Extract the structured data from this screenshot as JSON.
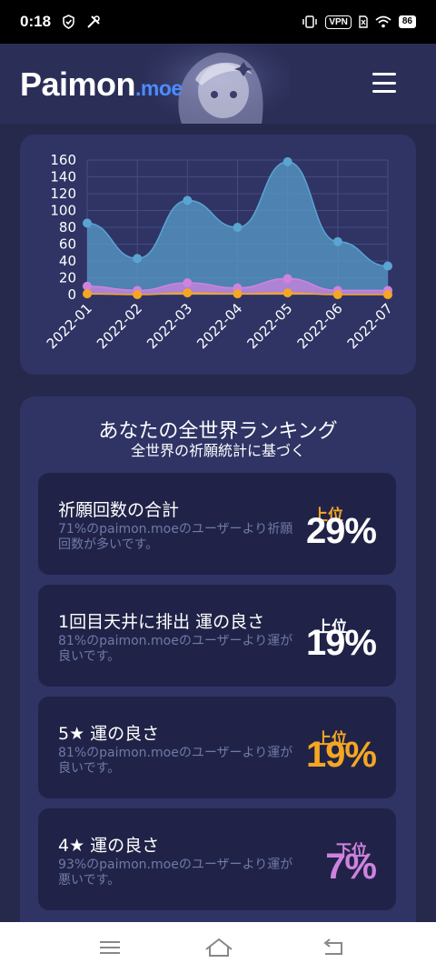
{
  "status_bar": {
    "time": "0:18",
    "vpn_label": "VPN",
    "battery_level": "86",
    "icons": [
      "shield-check-icon",
      "tools-icon",
      "vibrate-icon",
      "vpn-icon",
      "sim-icon",
      "wifi-icon",
      "battery-icon"
    ]
  },
  "header": {
    "logo_main": "Paimon",
    "logo_suffix": ".moe",
    "menu_icon": "hamburger-menu-icon",
    "art": "paimon-character-art"
  },
  "colors": {
    "page_bg": "#26294b",
    "card_bg": "#2f3465",
    "item_bg": "#202347",
    "accent_blue": "#4d8bff",
    "five_star": "#f5a623",
    "four_star": "#cf82e0",
    "total_area": "#4a8fc0"
  },
  "chart_data": {
    "type": "area",
    "x": [
      "2022-01",
      "2022-02",
      "2022-03",
      "2022-04",
      "2022-05",
      "2022-06",
      "2022-07"
    ],
    "ylim": [
      0,
      160
    ],
    "yticks": [
      0,
      20,
      40,
      60,
      80,
      100,
      120,
      140,
      160
    ],
    "grid": true,
    "series": [
      {
        "color": "#5aa4d2",
        "values": [
          85,
          43,
          112,
          80,
          158,
          63,
          34
        ]
      },
      {
        "color": "#cf82e0",
        "values": [
          10,
          5,
          14,
          8,
          19,
          5,
          5
        ]
      },
      {
        "color": "#f5a623",
        "values": [
          1,
          0,
          2,
          1,
          2,
          0,
          0
        ]
      }
    ]
  },
  "ranking": {
    "title": "あなたの全世界ランキング",
    "subtitle": "全世界の祈願統計に基づく",
    "items": [
      {
        "label": "祈願回数の合計",
        "desc": "71%のpaimon.moeのユーザーより祈願回数が多いです。",
        "position": "上位",
        "percent": "29%",
        "pos_color": "#f5a623",
        "pct_color": "#ffffff"
      },
      {
        "label": "1回目天井に排出 運の良さ",
        "desc": "81%のpaimon.moeのユーザーより運が良いです。",
        "position": "上位",
        "percent": "19%",
        "pos_color": "#ffffff",
        "pct_color": "#ffffff"
      },
      {
        "label": "5★ 運の良さ",
        "desc": "81%のpaimon.moeのユーザーより運が良いです。",
        "position": "上位",
        "percent": "19%",
        "pos_color": "#f5a623",
        "pct_color": "#f5a623"
      },
      {
        "label": "4★ 運の良さ",
        "desc": "93%のpaimon.moeのユーザーより運が悪いです。",
        "position": "下位",
        "percent": "7%",
        "pos_color": "#cf82e0",
        "pct_color": "#cf82e0"
      }
    ]
  },
  "nav_bar": {
    "icons": [
      "recent-apps-icon",
      "home-icon",
      "back-icon"
    ]
  }
}
